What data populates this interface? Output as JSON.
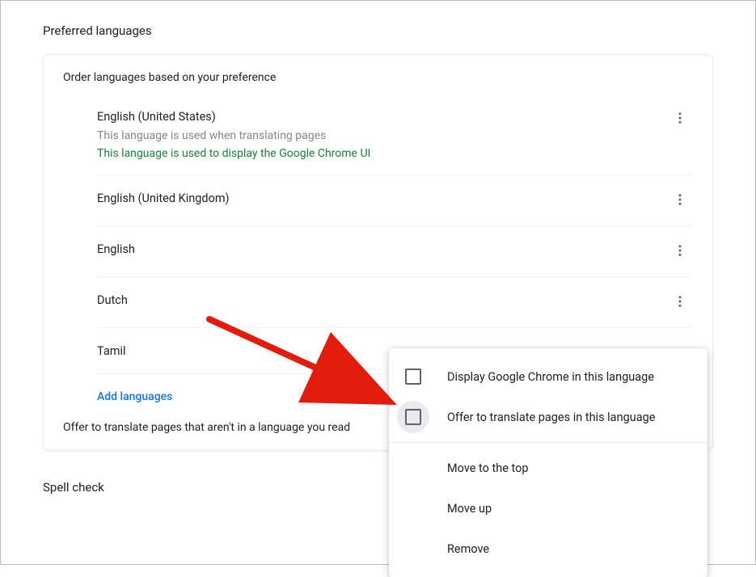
{
  "section_title": "Preferred languages",
  "card": {
    "header": "Order languages based on your preference",
    "languages": [
      {
        "name": "English (United States)",
        "sub_gray": "This language is used when translating pages",
        "sub_green": "This language is used to display the Google Chrome UI"
      },
      {
        "name": "English (United Kingdom)"
      },
      {
        "name": "English"
      },
      {
        "name": "Dutch"
      },
      {
        "name": "Tamil"
      }
    ],
    "add_label": "Add languages",
    "footer": "Offer to translate pages that aren't in a language you read"
  },
  "menu": {
    "display_chrome": "Display Google Chrome in this language",
    "offer_translate": "Offer to translate pages in this language",
    "move_top": "Move to the top",
    "move_up": "Move up",
    "remove": "Remove"
  },
  "spellcheck_title": "Spell check"
}
